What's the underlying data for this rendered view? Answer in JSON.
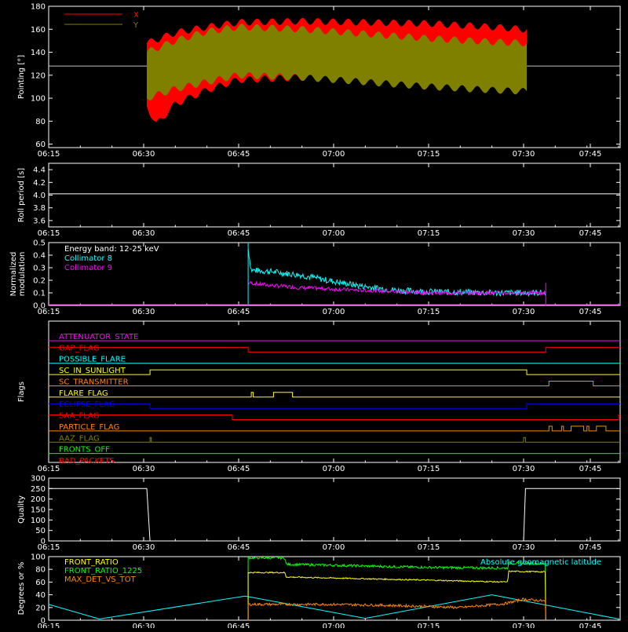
{
  "time_ticks": [
    "06:15",
    "06:30",
    "06:45",
    "07:00",
    "07:15",
    "07:30",
    "07:45"
  ],
  "axis_color": "#ffffff",
  "panels": [
    {
      "id": "pointing",
      "ylabel": "Pointing [°]",
      "ylim": [
        57,
        180
      ],
      "yticks": [
        60,
        80,
        100,
        120,
        140,
        160,
        180
      ],
      "legend": [
        {
          "name": "X",
          "color": "#ff0000"
        },
        {
          "name": "Y",
          "color": "#808000"
        }
      ],
      "reference_line": {
        "value": 128,
        "color": "#c0c0c0"
      }
    },
    {
      "id": "roll",
      "ylabel": "Roll period [s]",
      "ylim": [
        3.5,
        4.5
      ],
      "yticks": [
        "3.6",
        "3.8",
        "4.0",
        "4.2",
        "4.4"
      ],
      "reference_line": {
        "value": 4.02,
        "color": "#ffffff"
      }
    },
    {
      "id": "modulation",
      "ylabel_lines": [
        "Normalized",
        "modulation"
      ],
      "ylim": [
        0,
        0.5
      ],
      "yticks": [
        "0.0",
        "0.1",
        "0.2",
        "0.3",
        "0.4",
        "0.5"
      ],
      "legend": [
        {
          "name": "Energy band: 12-25 keV",
          "color": "#ffffff"
        },
        {
          "name": "Collimator 8",
          "color": "#00ffff"
        },
        {
          "name": "Collimator 9",
          "color": "#ff00ff"
        }
      ]
    },
    {
      "id": "flags",
      "ylabel": "Flags",
      "flags": [
        {
          "name": "ATTENUATOR_STATE",
          "color": "#ff00ff"
        },
        {
          "name": "GAP_FLAG",
          "color": "#ff0000"
        },
        {
          "name": "POSSIBLE_FLARE",
          "color": "#00ffff"
        },
        {
          "name": "SC_IN_SUNLIGHT",
          "color": "#ffff00"
        },
        {
          "name": "SC_TRANSMITTER",
          "color": "#ff8800"
        },
        {
          "name": "FLARE_FLAG",
          "color": "#ffff00"
        },
        {
          "name": "ECLIPSE_FLAG",
          "color": "#0000ff"
        },
        {
          "name": "SAA_FLAG",
          "color": "#ff0000"
        },
        {
          "name": "PARTICLE_FLAG",
          "color": "#ff8800"
        },
        {
          "name": "AAZ_FLAG",
          "color": "#808000"
        },
        {
          "name": "FRONTS_OFF",
          "color": "#00ff00"
        },
        {
          "name": "BAD_PACKETS",
          "color": "#ff0000"
        }
      ]
    },
    {
      "id": "quality",
      "ylabel": "Quality",
      "ylim": [
        0,
        300
      ],
      "yticks": [
        0,
        50,
        100,
        150,
        200,
        250,
        300
      ]
    },
    {
      "id": "ratios",
      "ylabel": "Degrees or %",
      "ylim": [
        0,
        100
      ],
      "yticks": [
        0,
        20,
        40,
        60,
        80,
        100
      ],
      "legend": [
        {
          "name": "FRONT_RATIO",
          "color": "#ffff00"
        },
        {
          "name": "FRONT_RATIO_1225",
          "color": "#00ff00"
        },
        {
          "name": "MAX_DET_VS_TOT",
          "color": "#ff8800"
        }
      ],
      "right_legend": {
        "name": "Absolute geomagnetic latitude",
        "color": "#00ffff"
      }
    }
  ],
  "chart_data": {
    "type": "line",
    "x_unit": "minutes from 06:15 UT",
    "xlim": [
      0,
      75
    ],
    "pointing": {
      "start": 15.5,
      "end": 75.5,
      "x_upper": [
        [
          15.5,
          148
        ],
        [
          20,
          157
        ],
        [
          25,
          162
        ],
        [
          30,
          166
        ],
        [
          40,
          167
        ],
        [
          50,
          166
        ],
        [
          60,
          165
        ],
        [
          70,
          162
        ],
        [
          75,
          160
        ]
      ],
      "x_lower": [
        [
          15.5,
          93
        ],
        [
          17,
          77
        ],
        [
          20,
          95
        ],
        [
          25,
          107
        ],
        [
          30,
          116
        ],
        [
          40,
          118
        ],
        [
          50,
          117
        ],
        [
          60,
          116
        ],
        [
          70,
          115
        ],
        [
          75,
          113
        ]
      ],
      "y_upper": [
        [
          15.5,
          140
        ],
        [
          20,
          150
        ],
        [
          25,
          158
        ],
        [
          30,
          162
        ],
        [
          40,
          160
        ],
        [
          50,
          156
        ],
        [
          60,
          152
        ],
        [
          70,
          149
        ],
        [
          75,
          148
        ]
      ],
      "y_lower": [
        [
          15.5,
          100
        ],
        [
          20,
          108
        ],
        [
          25,
          114
        ],
        [
          30,
          120
        ],
        [
          40,
          118
        ],
        [
          50,
          114
        ],
        [
          60,
          110
        ],
        [
          70,
          107
        ],
        [
          75,
          106
        ]
      ]
    },
    "modulation": {
      "start": 31.5,
      "end": 78.5,
      "collimator8": [
        [
          31.5,
          0.45
        ],
        [
          32,
          0.28
        ],
        [
          35,
          0.27
        ],
        [
          40,
          0.24
        ],
        [
          45,
          0.19
        ],
        [
          50,
          0.15
        ],
        [
          55,
          0.12
        ],
        [
          60,
          0.11
        ],
        [
          70,
          0.1
        ],
        [
          78.5,
          0.1
        ]
      ],
      "collimator9": [
        [
          31.5,
          0.18
        ],
        [
          35,
          0.16
        ],
        [
          40,
          0.14
        ],
        [
          45,
          0.13
        ],
        [
          50,
          0.12
        ],
        [
          55,
          0.11
        ],
        [
          60,
          0.1
        ],
        [
          70,
          0.1
        ],
        [
          78.5,
          0.1
        ]
      ]
    },
    "flags": [
      {
        "name": "ATTENUATOR_STATE",
        "base": 0,
        "segments": []
      },
      {
        "name": "GAP_FLAG",
        "base": 1,
        "segments": [
          [
            31.5,
            78.5
          ]
        ],
        "dir": -1
      },
      {
        "name": "POSSIBLE_FLARE",
        "base": 0,
        "segments": []
      },
      {
        "name": "SC_IN_SUNLIGHT",
        "base": 0,
        "segments": [
          [
            16,
            75.5
          ]
        ]
      },
      {
        "name": "SC_TRANSMITTER",
        "base": 0,
        "segments": [
          [
            79,
            86
          ]
        ]
      },
      {
        "name": "FLARE_FLAG",
        "base": 0,
        "segments": [
          [
            32,
            32.3
          ],
          [
            35.5,
            38.5
          ]
        ]
      },
      {
        "name": "ECLIPSE_FLAG",
        "base": 1,
        "segments": [
          [
            16,
            75.5
          ]
        ],
        "dir": -1
      },
      {
        "name": "SAA_FLAG",
        "base": 1,
        "segments": [
          [
            29,
            90
          ]
        ],
        "dir": -1
      },
      {
        "name": "PARTICLE_FLAG",
        "base": 0,
        "segments": [
          [
            79,
            79.5
          ],
          [
            81,
            81.3
          ],
          [
            82.5,
            84.5
          ],
          [
            85,
            85.3
          ],
          [
            86.5,
            88
          ]
        ]
      },
      {
        "name": "AAZ_FLAG",
        "base": 0,
        "segments": [
          [
            16,
            16.2
          ],
          [
            75,
            75.3
          ]
        ]
      },
      {
        "name": "FRONTS_OFF",
        "base": 0,
        "segments": []
      },
      {
        "name": "BAD_PACKETS",
        "base": 0,
        "segments": []
      }
    ],
    "quality": [
      [
        0,
        250
      ],
      [
        15.5,
        250
      ],
      [
        16,
        0
      ],
      [
        75,
        0
      ],
      [
        75.3,
        250
      ],
      [
        90,
        250
      ]
    ],
    "ratios": {
      "front_ratio": [
        [
          31.5,
          75
        ],
        [
          37.3,
          75
        ],
        [
          37.5,
          68
        ],
        [
          60,
          63
        ],
        [
          72.5,
          60
        ],
        [
          72.6,
          77
        ],
        [
          78.5,
          76
        ]
      ],
      "front_ratio_1225": [
        [
          31.5,
          98
        ],
        [
          37.3,
          98
        ],
        [
          37.5,
          88
        ],
        [
          60,
          83
        ],
        [
          72.5,
          82
        ],
        [
          72.6,
          90
        ],
        [
          78.5,
          89
        ]
      ],
      "max_det_vs_tot": [
        [
          31.5,
          25
        ],
        [
          45,
          25
        ],
        [
          55,
          23
        ],
        [
          65,
          20
        ],
        [
          72,
          26
        ],
        [
          75,
          33
        ],
        [
          78.5,
          30
        ]
      ],
      "geomagnetic_latitude": [
        [
          0,
          25
        ],
        [
          8,
          2
        ],
        [
          31,
          38
        ],
        [
          50,
          3
        ],
        [
          70,
          40
        ],
        [
          90,
          2
        ]
      ]
    }
  }
}
